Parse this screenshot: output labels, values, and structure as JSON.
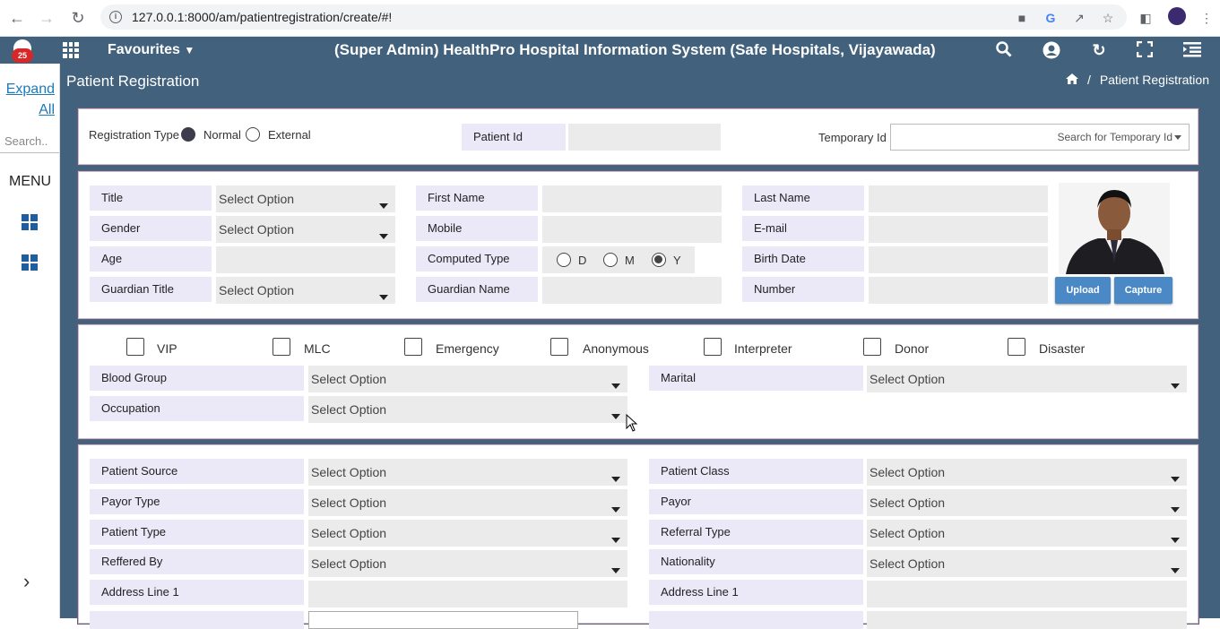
{
  "browser": {
    "url": "127.0.0.1:8000/am/patientregistration/create/#!",
    "back_icon": "back-arrow-icon",
    "forward_icon": "forward-arrow-icon",
    "reload_icon": "reload-icon"
  },
  "app": {
    "notification_count": "25",
    "favourites_label": "Favourites",
    "title": "(Super Admin) HealthPro Hospital Information System (Safe Hospitals, Vijayawada)",
    "header_color": "#41617c"
  },
  "sidebar": {
    "expand_label_1": "Expand",
    "expand_label_2": "All",
    "search_placeholder": "Search..",
    "menu_label": "MENU"
  },
  "page": {
    "title": "Patient Registration",
    "breadcrumb_sep": "/",
    "breadcrumb": "Patient Registration"
  },
  "registration": {
    "type_label": "Registration Type",
    "normal_label": "Normal",
    "external_label": "External",
    "selected": "Normal",
    "patient_id_label": "Patient Id",
    "temporary_id_label": "Temporary Id",
    "temporary_id_placeholder": "Search for Temporary Id"
  },
  "basic": {
    "title_label": "Title",
    "gender_label": "Gender",
    "age_label": "Age",
    "guardian_title_label": "Guardian Title",
    "first_name_label": "First Name",
    "mobile_label": "Mobile",
    "computed_type_label": "Computed Type",
    "computed_d": "D",
    "computed_m": "M",
    "computed_y": "Y",
    "computed_selected": "Y",
    "guardian_name_label": "Guardian Name",
    "last_name_label": "Last Name",
    "email_label": "E-mail",
    "birth_date_label": "Birth Date",
    "number_label": "Number",
    "select_option": "Select Option",
    "upload_label": "Upload",
    "capture_label": "Capture"
  },
  "flags": [
    "VIP",
    "MLC",
    "Emergency",
    "Anonymous",
    "Interpreter",
    "Donor",
    "Disaster"
  ],
  "extra": {
    "blood_group_label": "Blood Group",
    "occupation_label": "Occupation",
    "marital_label": "Marital"
  },
  "source": {
    "patient_source_label": "Patient Source",
    "payor_type_label": "Payor Type",
    "patient_type_label": "Patient Type",
    "reffered_by_label": "Reffered By",
    "address_line_1_label": "Address Line 1",
    "patient_class_label": "Patient Class",
    "payor_label": "Payor",
    "referral_type_label": "Referral Type",
    "nationality_label": "Nationality",
    "address_line_1_right_label": "Address Line 1"
  }
}
